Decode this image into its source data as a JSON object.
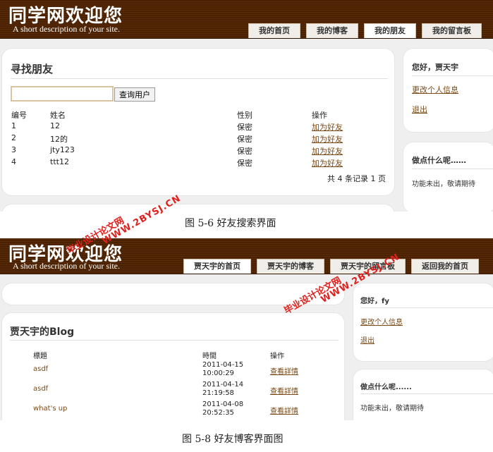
{
  "screen1": {
    "header": {
      "title": "同学网欢迎您",
      "description": "A short description of your site.",
      "tabs": [
        {
          "label": "我的首页"
        },
        {
          "label": "我的博客"
        },
        {
          "label": "我的朋友"
        },
        {
          "label": "我的留言板"
        }
      ]
    },
    "main": {
      "heading": "寻找朋友",
      "search_value": "",
      "search_button": "查询用户",
      "columns": [
        "编号",
        "姓名",
        "性别",
        "操作"
      ],
      "rows": [
        {
          "id": "1",
          "name": "12",
          "gender": "保密",
          "action": "加为好友"
        },
        {
          "id": "2",
          "name": "12的",
          "gender": "保密",
          "action": "加为好友"
        },
        {
          "id": "3",
          "name": "jty123",
          "gender": "保密",
          "action": "加为好友"
        },
        {
          "id": "4",
          "name": "ttt12",
          "gender": "保密",
          "action": "加为好友"
        }
      ],
      "summary": "共 4 条记录 1 页"
    },
    "sidebar": {
      "greeting": "您好，贾天宇",
      "edit_profile": "更改个人信息",
      "logout": "退出",
      "status_title": "做点什么呢……",
      "status_text": "功能未出，敬请期待"
    }
  },
  "caption1": "图 5-6 好友搜索界面",
  "screen2": {
    "header": {
      "title": "同学网欢迎您",
      "description": "A short description of your site.",
      "tabs": [
        {
          "label": "贾天宇的首页"
        },
        {
          "label": "贾天宇的博客"
        },
        {
          "label": "贾天宇的留言板"
        },
        {
          "label": "返回我的首页"
        }
      ]
    },
    "main": {
      "heading": "贾天宇的Blog",
      "columns": [
        "標題",
        "時間",
        "操作"
      ],
      "rows": [
        {
          "title": "asdf",
          "date": "2011-04-15",
          "time": "10:00:29",
          "action": "查看詳情"
        },
        {
          "title": "asdf",
          "date": "2011-04-14",
          "time": "21:19:58",
          "action": "查看詳情"
        },
        {
          "title": "what's up",
          "date": "2011-04-08",
          "time": "20:52:35",
          "action": "查看詳情"
        }
      ]
    },
    "sidebar": {
      "greeting": "您好，fy",
      "edit_profile": "更改个人信息",
      "logout": "退出",
      "status_title": "做点什么呢......",
      "status_text": "功能未出，敬请期待"
    }
  },
  "caption2": "图 5-8 好友博客界面图",
  "watermark": {
    "line1": "毕业设计论文网",
    "line2": "WWW.2BYSJ.CN",
    "color": "#e0201c"
  }
}
